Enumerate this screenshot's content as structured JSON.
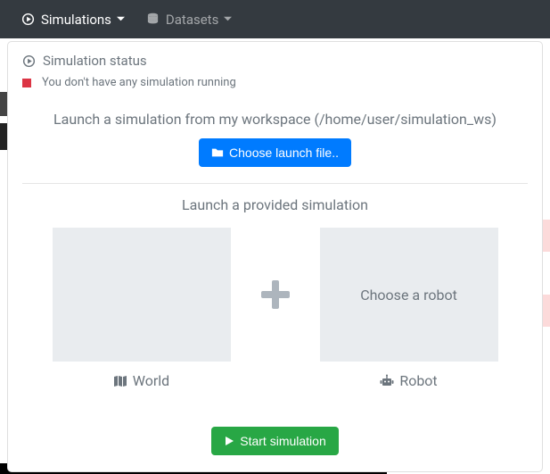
{
  "navbar": {
    "simulations_label": "Simulations",
    "datasets_label": "Datasets"
  },
  "panel": {
    "status_title": "Simulation status",
    "status_message": "You don't have any simulation running",
    "launch_workspace_text": "Launch a simulation from my workspace (/home/user/simulation_ws)",
    "choose_launch_file_label": "Choose launch file..",
    "provided_text": "Launch a provided simulation",
    "robot_tile_text": "Choose a robot",
    "world_label": "World",
    "robot_label": "Robot",
    "start_label": "Start simulation"
  }
}
